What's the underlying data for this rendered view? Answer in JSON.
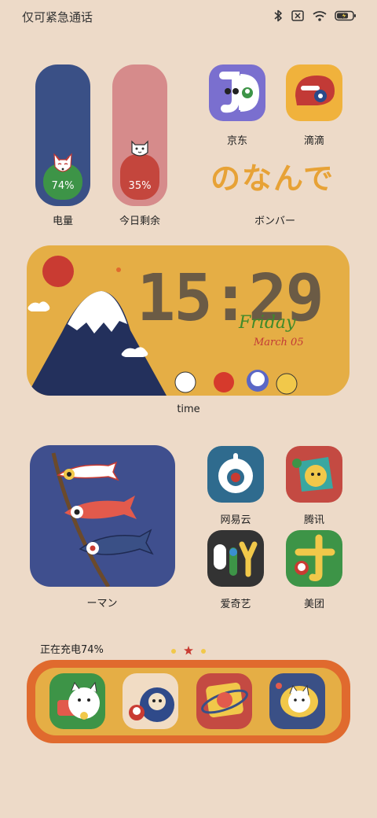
{
  "status_bar": {
    "carrier_text": "仅可紧急通话",
    "battery_percent": 74
  },
  "gauges": [
    {
      "label": "电量",
      "value_text": "74%",
      "level": 0.74
    },
    {
      "label": "今日剩余",
      "value_text": "35%",
      "level": 0.35
    }
  ],
  "apps_top": [
    {
      "label": "京东"
    },
    {
      "label": "滴滴"
    }
  ],
  "banner": {
    "title": "のなんで",
    "label": "ボンバー"
  },
  "clock": {
    "time": "15:29",
    "day": "Friday",
    "date": "March 05",
    "label": "time"
  },
  "fish_widget": {
    "label": "ーマン"
  },
  "apps_grid": [
    {
      "label": "网易云"
    },
    {
      "label": "腾讯"
    },
    {
      "label": "爱奇艺"
    },
    {
      "label": "美团"
    }
  ],
  "charging_text": "正在充电74%",
  "page_indicator": {
    "pages": 3,
    "current": 2
  },
  "colors": {
    "background": "#eddac8",
    "gauge_battery": "#3a5086",
    "gauge_battery_fill": "#3d9447",
    "gauge_remaining": "#d68b8b",
    "gauge_remaining_fill": "#c4463d",
    "widget_yellow": "#e5ae45",
    "dock_orange": "#e06a2e"
  }
}
